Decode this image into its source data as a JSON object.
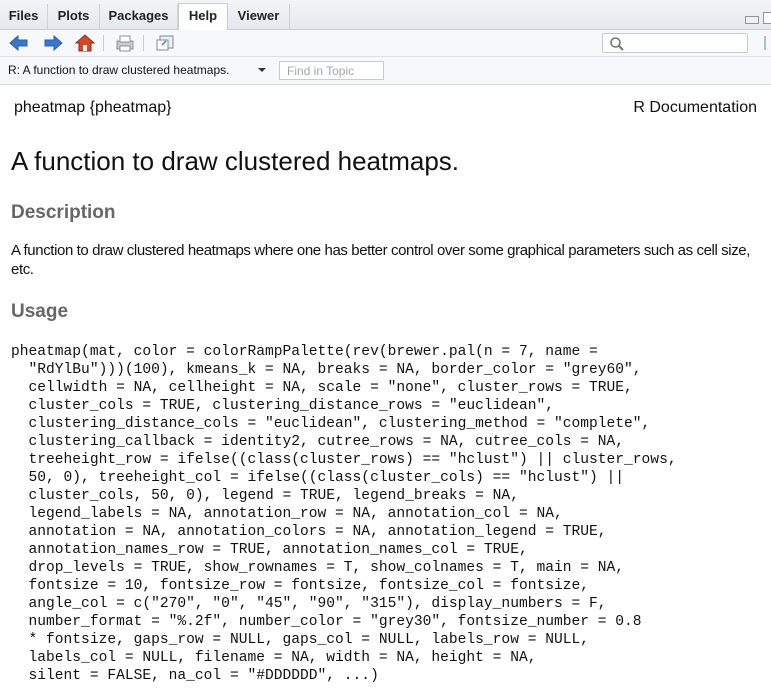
{
  "tabs": [
    {
      "label": "Files",
      "active": false
    },
    {
      "label": "Plots",
      "active": false
    },
    {
      "label": "Packages",
      "active": false
    },
    {
      "label": "Help",
      "active": true
    },
    {
      "label": "Viewer",
      "active": false
    }
  ],
  "toolbar": {
    "icons": [
      "back-arrow-icon",
      "forward-arrow-icon",
      "home-icon",
      "print-icon",
      "open-in-window-icon"
    ],
    "search_placeholder": ""
  },
  "topic_bar": {
    "selected_topic": "R: A function to draw clustered heatmaps.",
    "find_placeholder": "Find in Topic"
  },
  "doc": {
    "package_header": "pheatmap {pheatmap}",
    "r_documentation": "R Documentation",
    "title": "A function to draw clustered heatmaps.",
    "description_heading": "Description",
    "description_text": "A function to draw clustered heatmaps where one has better control over some graphical parameters such as cell size, etc.",
    "usage_heading": "Usage",
    "usage_lines": [
      "pheatmap(mat, color = colorRampPalette(rev(brewer.pal(n = 7, name =",
      "  \"RdYlBu\")))(100), kmeans_k = NA, breaks = NA, border_color = \"grey60\",",
      "  cellwidth = NA, cellheight = NA, scale = \"none\", cluster_rows = TRUE,",
      "  cluster_cols = TRUE, clustering_distance_rows = \"euclidean\",",
      "  clustering_distance_cols = \"euclidean\", clustering_method = \"complete\",",
      "  clustering_callback = identity2, cutree_rows = NA, cutree_cols = NA,",
      "  treeheight_row = ifelse((class(cluster_rows) == \"hclust\") || cluster_rows,",
      "  50, 0), treeheight_col = ifelse((class(cluster_cols) == \"hclust\") ||",
      "  cluster_cols, 50, 0), legend = TRUE, legend_breaks = NA,",
      "  legend_labels = NA, annotation_row = NA, annotation_col = NA,",
      "  annotation = NA, annotation_colors = NA, annotation_legend = TRUE,",
      "  annotation_names_row = TRUE, annotation_names_col = TRUE,",
      "  drop_levels = TRUE, show_rownames = T, show_colnames = T, main = NA,",
      "  fontsize = 10, fontsize_row = fontsize, fontsize_col = fontsize,",
      "  angle_col = c(\"270\", \"0\", \"45\", \"90\", \"315\"), display_numbers = F,",
      "  number_format = \"%.2f\", number_color = \"grey30\", fontsize_number = 0.8",
      "  * fontsize, gaps_row = NULL, gaps_col = NULL, labels_row = NULL,",
      "  labels_col = NULL, filename = NA, width = NA, height = NA,",
      "  silent = FALSE, na_col = \"#DDDDDD\", ...)"
    ]
  },
  "colors": {
    "tabbar_bg": "#e4e8ee",
    "heading_gray": "#666666",
    "nav_arrow_blue": "#3a78c9",
    "home_red": "#d04a2a"
  }
}
